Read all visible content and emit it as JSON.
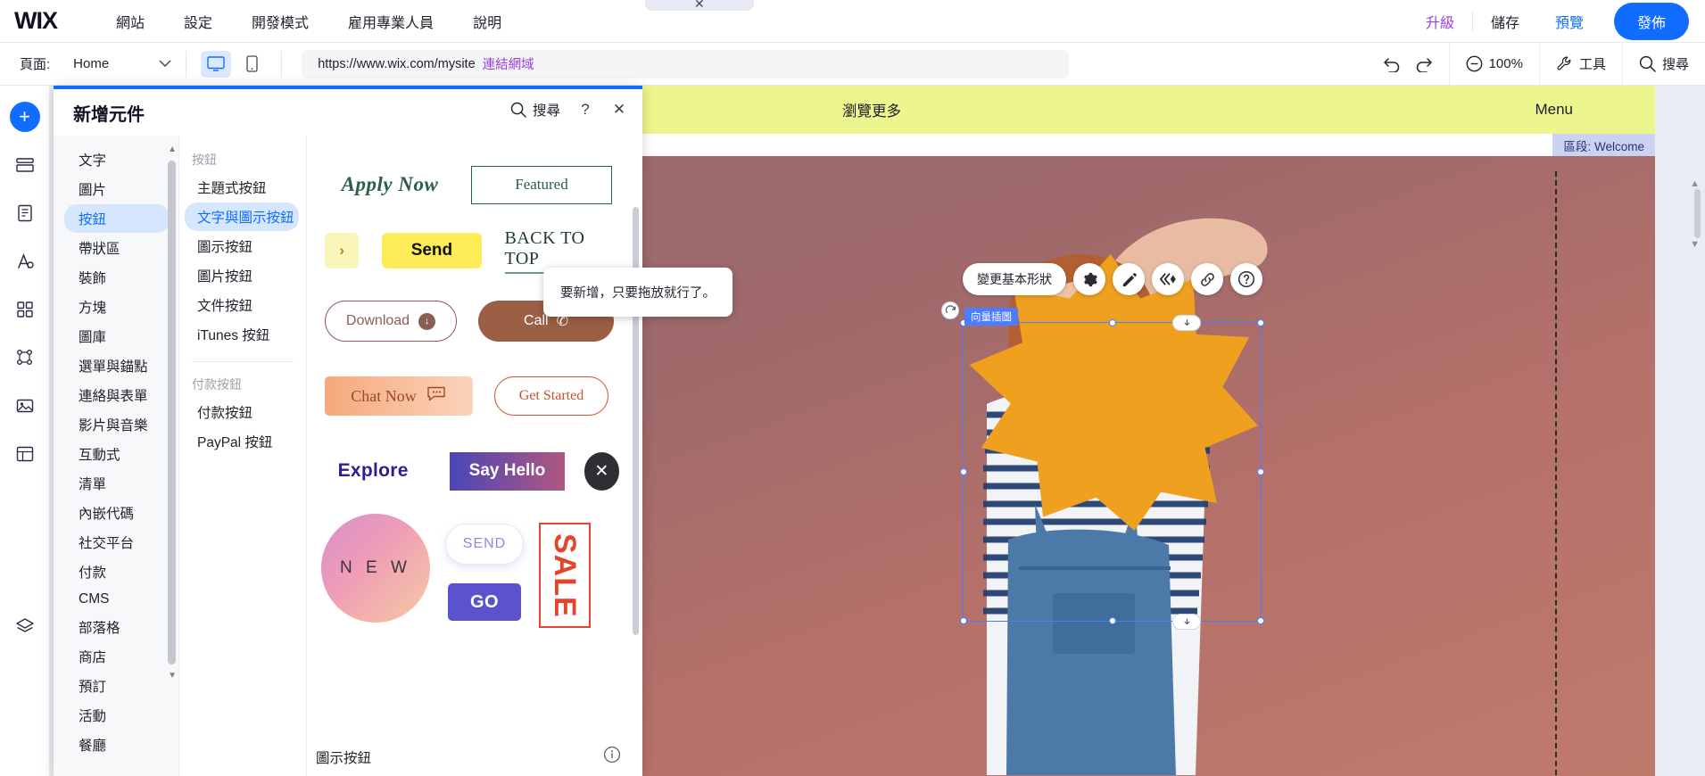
{
  "brand": {
    "logo": "WIX",
    "accent": "#116dff",
    "upgrade_color": "#9a3fd8"
  },
  "topbar": {
    "menu": [
      "網站",
      "設定",
      "開發模式",
      "雇用專業人員",
      "說明"
    ],
    "upgrade": "升級",
    "save": "儲存",
    "preview": "預覽",
    "publish": "發佈"
  },
  "secondbar": {
    "page_label": "頁面:",
    "page_name": "Home",
    "url": "https://www.wix.com/mysite",
    "url_link_label": "連結網域",
    "zoom": "100%",
    "tools": "工具",
    "search": "搜尋",
    "undo_icon": "undo-icon",
    "redo_icon": "redo-icon",
    "desktop_icon": "desktop-icon",
    "mobile_icon": "mobile-icon"
  },
  "left_rail": {
    "items": [
      {
        "icon": "add-plus-icon",
        "name": "add-elements"
      },
      {
        "icon": "pages-icon",
        "name": "site-pages"
      },
      {
        "icon": "page-design-icon",
        "name": "page-design"
      },
      {
        "icon": "theme-icon",
        "name": "site-theme"
      },
      {
        "icon": "apps-icon",
        "name": "app-market"
      },
      {
        "icon": "cms-icon",
        "name": "cms"
      },
      {
        "icon": "media-icon",
        "name": "media"
      },
      {
        "icon": "blocks-icon",
        "name": "blocks"
      },
      {
        "icon": "layers-icon",
        "name": "layers"
      }
    ]
  },
  "add_panel": {
    "title": "新增元件",
    "search": "搜尋",
    "help_icon": "question-mark-icon",
    "close_icon": "close-icon",
    "categories": [
      "文字",
      "圖片",
      "按鈕",
      "帶狀區",
      "裝飾",
      "方塊",
      "圖庫",
      "選單與錨點",
      "連絡與表單",
      "影片與音樂",
      "互動式",
      "清單",
      "內嵌代碼",
      "社交平台",
      "付款",
      "CMS",
      "部落格",
      "商店",
      "預訂",
      "活動",
      "餐廳"
    ],
    "active_category": "按鈕",
    "sub_groups": [
      {
        "header": "按鈕",
        "items": [
          "主題式按鈕",
          "文字與圖示按鈕",
          "圖示按鈕",
          "圖片按鈕",
          "文件按鈕",
          "iTunes 按鈕"
        ]
      },
      {
        "header": "付款按鈕",
        "items": [
          "付款按鈕",
          "PayPal 按鈕"
        ]
      }
    ],
    "active_sub": "文字與圖示按鈕",
    "gallery": {
      "rows": [
        [
          {
            "name": "apply-now-button",
            "label": "Apply Now"
          },
          {
            "name": "featured-button",
            "label": "Featured"
          }
        ],
        [
          {
            "name": "arrow-button",
            "label": "›"
          },
          {
            "name": "send-button",
            "label": "Send"
          },
          {
            "name": "back-to-top-button",
            "label": "BACK TO TOP"
          }
        ],
        [
          {
            "name": "download-button",
            "label": "Download"
          },
          {
            "name": "call-button",
            "label": "Call"
          }
        ],
        [
          {
            "name": "chat-now-button",
            "label": "Chat Now"
          },
          {
            "name": "get-started-button",
            "label": "Get Started"
          }
        ],
        [
          {
            "name": "explore-button",
            "label": "Explore"
          },
          {
            "name": "say-hello-button",
            "label": "Say Hello"
          },
          {
            "name": "close-x-button",
            "label": "✕"
          }
        ],
        [
          {
            "name": "new-circle-button",
            "label": "N E W"
          },
          {
            "name": "send-pill-button",
            "label": "SEND"
          },
          {
            "name": "sale-button",
            "label": "SALE"
          },
          {
            "name": "go-button",
            "label": "GO"
          }
        ]
      ],
      "footer_label": "圖示按鈕",
      "footer_info_icon": "info-icon"
    }
  },
  "canvas": {
    "browse_more": "瀏覽更多",
    "menu": "Menu",
    "zone_label": "區段: Welcome",
    "selection_tag": "向量插圖",
    "tooltip": "要新增，只要拖放就行了。",
    "element_toolbar": {
      "change_shape": "變更基本形狀",
      "icons": [
        {
          "name": "gear-icon",
          "glyph": "settings"
        },
        {
          "name": "pen-icon",
          "glyph": "design"
        },
        {
          "name": "animation-icon",
          "glyph": "animation"
        },
        {
          "name": "link-icon",
          "glyph": "link"
        },
        {
          "name": "help-icon",
          "glyph": "help"
        }
      ]
    },
    "rotate_icon": "rotate-handle-icon",
    "stretch_icon": "stretch-handle-icon"
  }
}
